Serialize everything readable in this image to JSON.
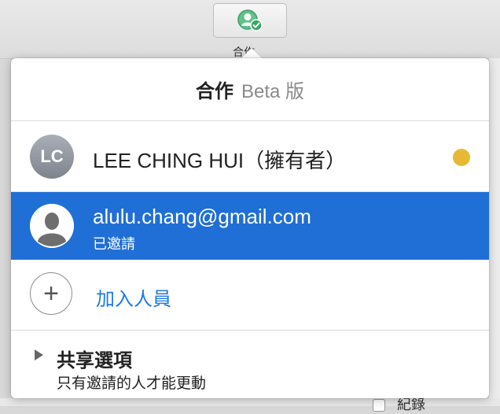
{
  "toolbar": {
    "collaborate_label": "合作"
  },
  "popover": {
    "title": "合作",
    "badge": "Beta 版",
    "owner": {
      "initials": "LC",
      "name": "LEE CHING HUI（擁有者）",
      "status_color": "#e6b935"
    },
    "invited": {
      "email": "alulu.chang@gmail.com",
      "status": "已邀請",
      "highlight_color": "#1f6fd6"
    },
    "add_person": {
      "label": "加入人員"
    },
    "share_options": {
      "title": "共享選項",
      "subtitle": "只有邀請的人才能更動"
    }
  },
  "background": {
    "partial_text": "紀錄"
  }
}
